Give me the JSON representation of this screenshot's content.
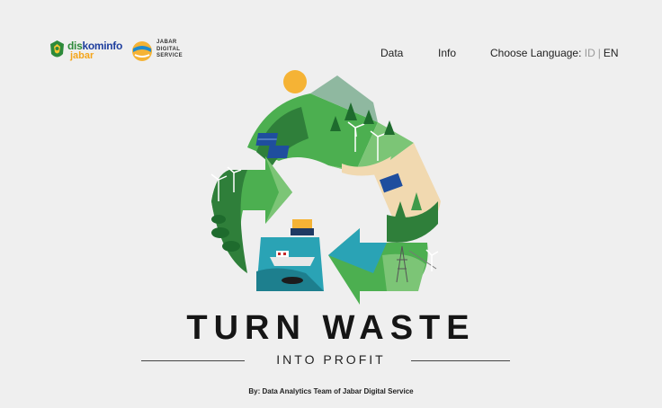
{
  "header": {
    "logo_diskominfo": {
      "word1a": "dis",
      "word1b": "kominfo",
      "word2": "jabar"
    },
    "logo_jds": {
      "text": "JABAR\nDIGITAL\nSERVICE"
    },
    "nav": {
      "data_label": "Data",
      "info_label": "Info",
      "language_label": "Choose Language:",
      "lang_id": "ID",
      "lang_sep": "|",
      "lang_en": "EN"
    }
  },
  "hero": {
    "title": "TURN WASTE",
    "subtitle": "INTO PROFIT",
    "byline": "By: Data Analytics Team of Jabar Digital Service"
  },
  "colors": {
    "background": "#efefef",
    "green_dark": "#2f7f3a",
    "green_mid": "#4caf50",
    "green_light": "#7cc576",
    "teal": "#2aa3b5",
    "sun": "#f5b335",
    "sand": "#f1d9b0"
  }
}
